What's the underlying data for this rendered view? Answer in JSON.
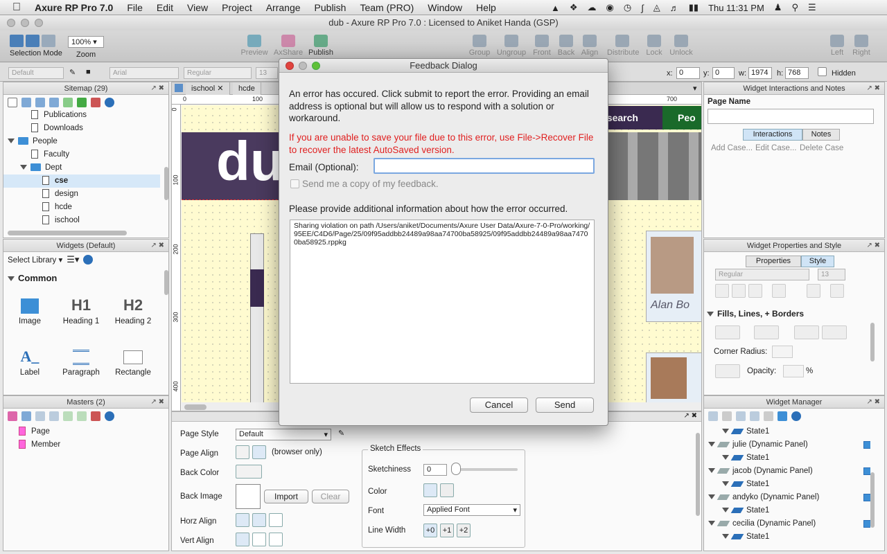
{
  "menubar": {
    "app": "Axure RP Pro 7.0",
    "items": [
      "File",
      "Edit",
      "View",
      "Project",
      "Arrange",
      "Publish",
      "Team (PRO)",
      "Window",
      "Help"
    ],
    "clock": "Thu 11:31 PM"
  },
  "window": {
    "title": "dub - Axure RP Pro 7.0 : Licensed to Aniket Handa (GSP)"
  },
  "toolbar": {
    "selection_mode": "Selection Mode",
    "zoom_value": "100%",
    "zoom_label": "Zoom",
    "preview": "Preview",
    "axshare": "AxShare",
    "publish": "Publish",
    "group": "Group",
    "ungroup": "Ungroup",
    "front": "Front",
    "back": "Back",
    "align": "Align",
    "distribute": "Distribute",
    "lock": "Lock",
    "unlock": "Unlock",
    "left": "Left",
    "right": "Right"
  },
  "formatbar": {
    "style": "Default",
    "font": "Arial",
    "weight": "Regular",
    "size": "13",
    "x_label": "x:",
    "x": "0",
    "y_label": "y:",
    "y": "0",
    "w_label": "w:",
    "w": "1974",
    "h_label": "h:",
    "h": "768",
    "hidden": "Hidden"
  },
  "sitemap": {
    "title": "Sitemap (29)",
    "rows": [
      "Publications",
      "Downloads",
      "People",
      "Faculty",
      "Dept",
      "cse",
      "design",
      "hcde",
      "ischool"
    ]
  },
  "widgets": {
    "title": "Widgets (Default)",
    "select_library": "Select Library",
    "category": "Common",
    "items": [
      {
        "glyph": "",
        "label": "Image"
      },
      {
        "glyph": "H1",
        "label": "Heading 1"
      },
      {
        "glyph": "H2",
        "label": "Heading 2"
      },
      {
        "glyph": "A_",
        "label": "Label"
      },
      {
        "glyph": "",
        "label": "Paragraph"
      },
      {
        "glyph": "",
        "label": "Rectangle"
      }
    ]
  },
  "masters": {
    "title": "Masters (2)",
    "items": [
      "Page",
      "Member"
    ]
  },
  "canvas": {
    "tabs": [
      "ischool",
      "hcde"
    ],
    "ruler_h": [
      "0",
      "100",
      "700"
    ],
    "ruler_v": [
      "0",
      "100",
      "200",
      "300",
      "400"
    ],
    "nav_research": "esearch",
    "nav_people": "Peo",
    "person_name": "Alan Bo",
    "logo": "dub"
  },
  "page_props": {
    "page_style_label": "Page Style",
    "page_style": "Default",
    "page_align_label": "Page Align",
    "browser_only": "(browser only)",
    "back_color_label": "Back Color",
    "back_image_label": "Back Image",
    "import": "Import",
    "clear": "Clear",
    "horz_align_label": "Horz Align",
    "vert_align_label": "Vert Align",
    "sketch_title": "Sketch Effects",
    "sketchiness_label": "Sketchiness",
    "sketchiness": "0",
    "color_label": "Color",
    "font_label": "Font",
    "font_value": "Applied Font",
    "line_width_label": "Line Width",
    "line_widths": [
      "+0",
      "+1",
      "+2"
    ]
  },
  "interactions": {
    "title": "Widget Interactions and Notes",
    "page_name_label": "Page Name",
    "tab_interactions": "Interactions",
    "tab_notes": "Notes",
    "add_case": "Add Case...",
    "edit_case": "Edit Case...",
    "delete_case": "Delete Case"
  },
  "widget_props": {
    "title": "Widget Properties and Style",
    "tab_properties": "Properties",
    "tab_style": "Style",
    "weight": "Regular",
    "size": "13",
    "fills_title": "Fills, Lines, + Borders",
    "corner_radius": "Corner Radius:",
    "opacity": "Opacity:",
    "percent": "%"
  },
  "widget_manager": {
    "title": "Widget Manager",
    "rows": [
      {
        "text": "State1",
        "level": 1
      },
      {
        "text": "julie (Dynamic Panel)",
        "level": 0
      },
      {
        "text": "State1",
        "level": 1
      },
      {
        "text": "jacob (Dynamic Panel)",
        "level": 0
      },
      {
        "text": "State1",
        "level": 1
      },
      {
        "text": "andyko (Dynamic Panel)",
        "level": 0
      },
      {
        "text": "State1",
        "level": 1
      },
      {
        "text": "cecilia (Dynamic Panel)",
        "level": 0
      },
      {
        "text": "State1",
        "level": 1
      }
    ]
  },
  "dialog": {
    "title": "Feedback Dialog",
    "message": "An error has occured. Click submit to report the error. Providing an email address is optional but will allow us to respond with a solution or workaround.",
    "warning": "If you are unable to save your file due to this error, use File->Recover File to recover the latest AutoSaved version.",
    "email_label": "Email (Optional):",
    "email_value": "",
    "copy_label": "Send me a copy of my feedback.",
    "info_label": "Please provide additional information about how the error occurred.",
    "details": "Sharing violation on path /Users/aniket/Documents/Axure User Data/Axure-7-0-Pro/working/95EE/C4D6/Page/25/09f95addbb24489a98aa74700ba58925/09f95addbb24489a98aa74700ba58925.rppkg",
    "cancel": "Cancel",
    "send": "Send"
  },
  "colors": {
    "accent": "#3d8fd6",
    "warning": "#e02020",
    "banner": "#4a3a5e",
    "selected_row": "#d6e8f8"
  }
}
